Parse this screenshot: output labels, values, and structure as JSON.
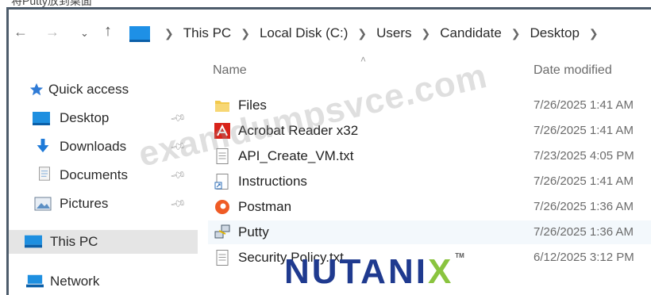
{
  "top_caption": "将Putty放到桌面",
  "address_bar": {
    "crumbs": [
      "This PC",
      "Local Disk (C:)",
      "Users",
      "Candidate",
      "Desktop"
    ]
  },
  "nav_pane": {
    "items": [
      {
        "label": "Quick access",
        "icon": "star-icon"
      },
      {
        "label": "Desktop",
        "icon": "desktop-icon",
        "pinned": true
      },
      {
        "label": "Downloads",
        "icon": "download-arrow-icon",
        "pinned": true
      },
      {
        "label": "Documents",
        "icon": "documents-icon",
        "pinned": true
      },
      {
        "label": "Pictures",
        "icon": "pictures-icon",
        "pinned": true
      },
      {
        "label": "This PC",
        "icon": "computer-icon",
        "selected": true
      },
      {
        "label": "Network",
        "icon": "network-icon"
      }
    ]
  },
  "columns": {
    "name": "Name",
    "date_modified": "Date modified"
  },
  "files": [
    {
      "name": "Files",
      "date": "7/26/2025 1:41 AM",
      "icon": "folder-icon"
    },
    {
      "name": "Acrobat Reader x32",
      "date": "7/26/2025 1:41 AM",
      "icon": "acrobat-icon"
    },
    {
      "name": "API_Create_VM.txt",
      "date": "7/23/2025 4:05 PM",
      "icon": "text-file-icon"
    },
    {
      "name": "Instructions",
      "date": "7/26/2025 1:41 AM",
      "icon": "shortcut-file-icon"
    },
    {
      "name": "Postman",
      "date": "7/26/2025 1:36 AM",
      "icon": "postman-icon"
    },
    {
      "name": "Putty",
      "date": "7/26/2025 1:36 AM",
      "icon": "putty-icon",
      "hover": true
    },
    {
      "name": "Security Policy.txt",
      "date": "6/12/2025 3:12 PM",
      "icon": "text-file-icon"
    }
  ],
  "watermark": "examdumpsvce.com",
  "logo": {
    "prefix": "NUTANI",
    "suffix": "X",
    "tm": "TM"
  }
}
